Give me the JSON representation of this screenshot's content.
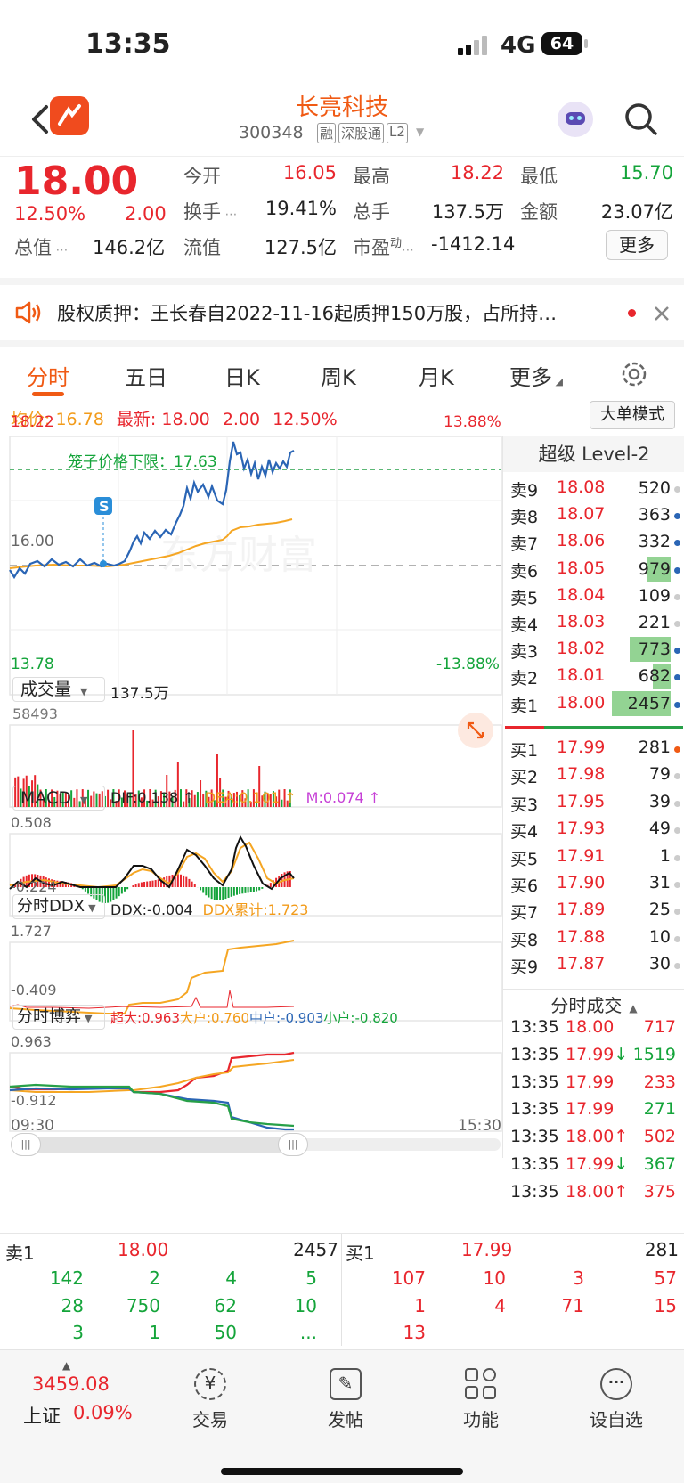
{
  "status_bar": {
    "time": "13:35",
    "network": "4G",
    "battery": "64"
  },
  "nav": {
    "title": "长亮科技",
    "code": "300348",
    "badges": [
      "融",
      "深股通",
      "L2"
    ]
  },
  "quote": {
    "price": "18.00",
    "change_pct": "12.50%",
    "change": "2.00",
    "fields": [
      {
        "label": "今开",
        "value": "16.05",
        "color": "red"
      },
      {
        "label": "最高",
        "value": "18.22",
        "color": "red"
      },
      {
        "label": "最低",
        "value": "15.70",
        "color": "green"
      },
      {
        "label": "换手",
        "value": "19.41%",
        "color": "black"
      },
      {
        "label": "总手",
        "value": "137.5万",
        "color": "black"
      },
      {
        "label": "金额",
        "value": "23.07亿",
        "color": "black"
      },
      {
        "label": "总值",
        "value": "146.2亿",
        "color": "black"
      },
      {
        "label": "流值",
        "value": "127.5亿",
        "color": "black"
      },
      {
        "label": "市盈",
        "value": "-1412.14",
        "color": "black"
      }
    ],
    "pe_sup": "动",
    "more_button": "更多"
  },
  "notice": {
    "text": "股权质押：王长春自2022-11-16起质押150万股，占所持…"
  },
  "tabs": [
    "分时",
    "五日",
    "日K",
    "周K",
    "月K",
    "更多"
  ],
  "summary": {
    "avg_label": "均价:",
    "avg": "16.78",
    "last_label": "最新:",
    "last": "18.00",
    "chg": "2.00",
    "pct": "12.50%",
    "mode_button": "大单模式"
  },
  "price_chart": {
    "high": "18.22",
    "high_pct": "13.88%",
    "low": "13.78",
    "low_pct": "-13.88%",
    "pre_close": "16.00",
    "limit_label": "笼子价格下限：17.63",
    "marker": "S",
    "watermark": "东方财富"
  },
  "volume_panel": {
    "selector": "成交量",
    "total": "137.5万",
    "max": "58493"
  },
  "macd_panel": {
    "selector": "MACD",
    "dif": "DIF:0.138",
    "dea": "DEA:0.101",
    "m": "M:0.074",
    "max": "0.508",
    "min": "-0.224"
  },
  "ddx_panel": {
    "selector": "分时DDX",
    "ddx": "DDX:-0.004",
    "ddx_sum": "DDX累计:1.723",
    "max": "1.727",
    "min": "-0.409"
  },
  "game_panel": {
    "selector": "分时博弈",
    "super": "超大:0.963",
    "large": "大户:0.760",
    "mid": "中户:-0.903",
    "small": "小户:-0.820",
    "max": "0.963",
    "min": "-0.912"
  },
  "time_axis": {
    "start": "09:30",
    "end": "15:30"
  },
  "level2": {
    "title": "超级 Level-2",
    "asks": [
      {
        "label": "卖9",
        "price": "18.08",
        "vol": "520"
      },
      {
        "label": "卖8",
        "price": "18.07",
        "vol": "363"
      },
      {
        "label": "卖7",
        "price": "18.06",
        "vol": "332"
      },
      {
        "label": "卖6",
        "price": "18.05",
        "vol": "979"
      },
      {
        "label": "卖5",
        "price": "18.04",
        "vol": "109"
      },
      {
        "label": "卖4",
        "price": "18.03",
        "vol": "221"
      },
      {
        "label": "卖3",
        "price": "18.02",
        "vol": "773"
      },
      {
        "label": "卖2",
        "price": "18.01",
        "vol": "682"
      },
      {
        "label": "卖1",
        "price": "18.00",
        "vol": "2457"
      }
    ],
    "bids": [
      {
        "label": "买1",
        "price": "17.99",
        "vol": "281"
      },
      {
        "label": "买2",
        "price": "17.98",
        "vol": "79"
      },
      {
        "label": "买3",
        "price": "17.95",
        "vol": "39"
      },
      {
        "label": "买4",
        "price": "17.93",
        "vol": "49"
      },
      {
        "label": "买5",
        "price": "17.91",
        "vol": "1"
      },
      {
        "label": "买6",
        "price": "17.90",
        "vol": "31"
      },
      {
        "label": "买7",
        "price": "17.89",
        "vol": "25"
      },
      {
        "label": "买8",
        "price": "17.88",
        "vol": "10"
      },
      {
        "label": "买9",
        "price": "17.87",
        "vol": "30"
      }
    ],
    "ticks_title": "分时成交",
    "ticks": [
      {
        "time": "13:35",
        "price": "18.00",
        "dir": "",
        "vol": "717",
        "color": "red"
      },
      {
        "time": "13:35",
        "price": "17.99",
        "dir": "↓",
        "vol": "1519",
        "color": "green"
      },
      {
        "time": "13:35",
        "price": "17.99",
        "dir": "",
        "vol": "233",
        "color": "red"
      },
      {
        "time": "13:35",
        "price": "17.99",
        "dir": "",
        "vol": "271",
        "color": "green"
      },
      {
        "time": "13:35",
        "price": "18.00",
        "dir": "↑",
        "vol": "502",
        "color": "red"
      },
      {
        "time": "13:35",
        "price": "17.99",
        "dir": "↓",
        "vol": "367",
        "color": "green"
      },
      {
        "time": "13:35",
        "price": "18.00",
        "dir": "↑",
        "vol": "375",
        "color": "red"
      }
    ]
  },
  "queue": {
    "ask_label": "卖1",
    "ask_price": "18.00",
    "ask_vol": "2457",
    "bid_label": "买1",
    "bid_price": "17.99",
    "bid_vol": "281",
    "ask_rows": [
      [
        "142",
        "2",
        "4",
        "5"
      ],
      [
        "28",
        "750",
        "62",
        "10"
      ],
      [
        "3",
        "1",
        "50",
        "..."
      ]
    ],
    "bid_rows": [
      [
        "107",
        "10",
        "3",
        "57"
      ],
      [
        "1",
        "4",
        "71",
        "15"
      ],
      [
        "13",
        "",
        "",
        ""
      ]
    ]
  },
  "bottom_nav": {
    "index_value": "3459.08",
    "index_name": "上证",
    "index_pct": "0.09%",
    "items": [
      "交易",
      "发帖",
      "功能",
      "设自选"
    ]
  }
}
